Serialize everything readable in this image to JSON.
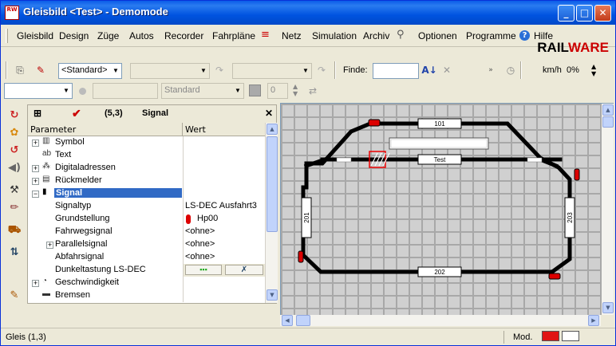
{
  "window": {
    "app_icon_text": "RW",
    "title": "Gleisbild <Test> - Demomode",
    "minimize": "_",
    "maximize": "□",
    "close": "✕"
  },
  "menu": {
    "items": [
      "Gleisbild",
      "Design",
      "Züge",
      "Autos",
      "Recorder",
      "Fahrpläne",
      "Netz",
      "Simulation",
      "Archiv",
      "Optionen",
      "Programme",
      "Hilfe"
    ]
  },
  "logo": {
    "part1": "RAIL",
    "part2": "WARE"
  },
  "toolbar1": {
    "standard_combo": "<Standard>",
    "finde_label": "Finde:",
    "finde_value": "",
    "speed_unit": "km/h",
    "speed_value": "0%"
  },
  "toolbar2": {
    "standard_combo": "Standard",
    "number_value": "0"
  },
  "panel": {
    "coords": "(5,3)",
    "title": "Signal",
    "close": "✕",
    "col_param": "Parameter",
    "col_value": "Wert",
    "rows": [
      {
        "name": "Symbol",
        "value": "",
        "expander": "+",
        "indent": 0,
        "icon": "symbol-icon"
      },
      {
        "name": "Text",
        "value": "",
        "expander": "",
        "indent": 0,
        "icon": "text-icon"
      },
      {
        "name": "Digitaladressen",
        "value": "",
        "expander": "+",
        "indent": 0,
        "icon": "digital-address-icon"
      },
      {
        "name": "Rückmelder",
        "value": "",
        "expander": "+",
        "indent": 0,
        "icon": "feedback-icon"
      },
      {
        "name": "Signal",
        "value": "",
        "expander": "−",
        "indent": 0,
        "icon": "signal-icon",
        "selected": true
      },
      {
        "name": "Signaltyp",
        "value": "LS-DEC Ausfahrt3",
        "expander": "",
        "indent": 1
      },
      {
        "name": "Grundstellung",
        "value": "Hp00",
        "expander": "",
        "indent": 1
      },
      {
        "name": "Fahrwegsignal",
        "value": "<ohne>",
        "expander": "",
        "indent": 1
      },
      {
        "name": "Parallelsignal",
        "value": "<ohne>",
        "expander": "+",
        "indent": 1
      },
      {
        "name": "Abfahrsignal",
        "value": "<ohne>",
        "expander": "",
        "indent": 1
      },
      {
        "name": "Dunkeltastung LS-DEC",
        "value": "",
        "expander": "",
        "indent": 1
      },
      {
        "name": "Geschwindigkeit",
        "value": "",
        "expander": "+",
        "indent": 0,
        "icon": "speed-icon"
      },
      {
        "name": "Bremsen",
        "value": "",
        "expander": "",
        "indent": 0,
        "icon": "brake-icon"
      }
    ]
  },
  "track": {
    "labels": {
      "top": "101",
      "left": "201",
      "right": "203",
      "bottom": "202",
      "station": "Test"
    }
  },
  "status": {
    "left": "Gleis (1,3)",
    "mode_label": "Mod."
  }
}
